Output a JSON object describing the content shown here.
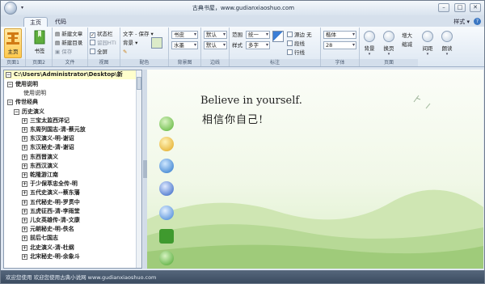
{
  "window": {
    "title": "古典书屋，www.gudianxiaoshuo.com",
    "minimize": "–",
    "maximize": "□",
    "close": "✕"
  },
  "tabs": [
    "主页",
    "代码"
  ],
  "style_menu": "样式",
  "ribbon": {
    "groups": [
      "页面1",
      "页面2",
      "文件",
      "视图",
      "配色",
      "背景图",
      "边线",
      "标注",
      "字体",
      "页面"
    ],
    "home_label": "主页",
    "bookmark_label": "书签",
    "new_article": "新建文章",
    "new_list": "新建目录",
    "save": "保存",
    "status_bar": "状态栏",
    "web_cache": "留园HTI",
    "fullscreen": "全屏",
    "text_save_label": "文字 - 保存",
    "background_label": "背景",
    "color_pen_label": "✎",
    "bookmark_combo": "书皮",
    "watercolor_combo": "水墨",
    "default_combo_1": "默认",
    "default_combo_2": "默认",
    "range_label": "范围",
    "range_value": "统一",
    "style_label": "样式",
    "style_value": "多字",
    "margin_label": "源边",
    "margin_value": "无",
    "paragraph_label": "段线",
    "row_label": "行线",
    "font_family": "楷体",
    "font_size": "28",
    "bg_btn": "背景",
    "pageturn_btn": "换页",
    "enlarge": "增大",
    "shrink": "缩减",
    "spacing_btn": "间距",
    "read_btn": "朗读"
  },
  "tree": {
    "path": "C:\\Users\\Administrator\\Desktop\\新",
    "items": [
      {
        "label": "使用说明",
        "level": 1,
        "toggle": "−",
        "bold": true
      },
      {
        "label": "使用说明",
        "level": 2,
        "toggle": "",
        "bold": false
      },
      {
        "label": "传世经典",
        "level": 1,
        "toggle": "−",
        "bold": true
      },
      {
        "label": "历史演义",
        "level": 2,
        "toggle": "−",
        "bold": true
      },
      {
        "label": "三宝太监西洋记",
        "level": 3,
        "toggle": "+",
        "bold": true
      },
      {
        "label": "东周列国志-清-蔡元放",
        "level": 3,
        "toggle": "+",
        "bold": true
      },
      {
        "label": "东汉演义-明-谢诏",
        "level": 3,
        "toggle": "+",
        "bold": true
      },
      {
        "label": "东汉秘史-清-谢诏",
        "level": 3,
        "toggle": "+",
        "bold": true
      },
      {
        "label": "东西晋演义",
        "level": 3,
        "toggle": "+",
        "bold": true
      },
      {
        "label": "东西汉演义",
        "level": 3,
        "toggle": "+",
        "bold": true
      },
      {
        "label": "乾隆游江南",
        "level": 3,
        "toggle": "+",
        "bold": true
      },
      {
        "label": "于少保萃忠全传-明",
        "level": 3,
        "toggle": "+",
        "bold": true
      },
      {
        "label": "五代史演义--蔡东藩",
        "level": 3,
        "toggle": "+",
        "bold": true
      },
      {
        "label": "五代秘史-明-罗贯中",
        "level": 3,
        "toggle": "+",
        "bold": true
      },
      {
        "label": "五虎征西-清-李雨堂",
        "level": 3,
        "toggle": "+",
        "bold": true
      },
      {
        "label": "儿女英雄传-清-文康",
        "level": 3,
        "toggle": "+",
        "bold": true
      },
      {
        "label": "元朝秘史-明-佚名",
        "level": 3,
        "toggle": "+",
        "bold": true
      },
      {
        "label": "前后七国志",
        "level": 3,
        "toggle": "+",
        "bold": true
      },
      {
        "label": "北史演义-清-杜纲",
        "level": 3,
        "toggle": "+",
        "bold": true
      },
      {
        "label": "北宋秘史-明-余象斗",
        "level": 3,
        "toggle": "+",
        "bold": true
      }
    ]
  },
  "reader": {
    "line1": "Believe in yourself.",
    "line2": "相信你自己!"
  },
  "status": "欢迎您使用 欢迎您使用古典小说网 www.gudianxiaoshuo.com",
  "colors": {
    "accent_yellow": "#ffc94d",
    "status_bar": "#3b4b60",
    "tree_highlight": "#ffffcc"
  }
}
